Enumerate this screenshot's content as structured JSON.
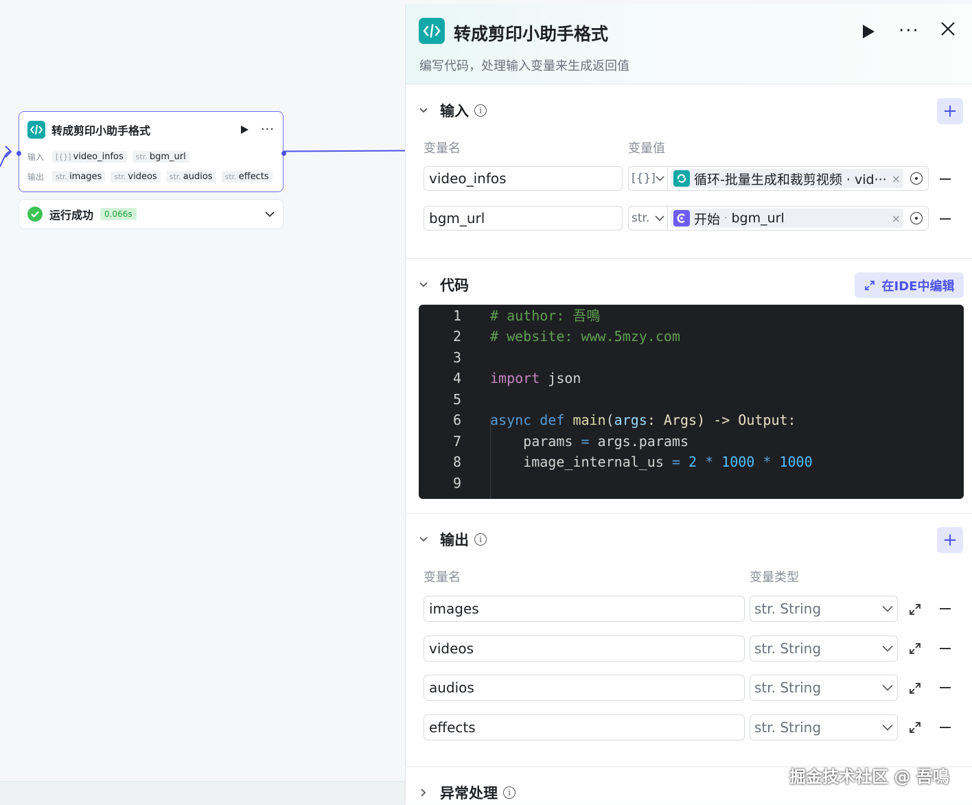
{
  "canvas": {
    "node": {
      "title": "转成剪印小助手格式",
      "input_label": "输入",
      "output_label": "输出",
      "inputs": [
        {
          "type": "[{}]",
          "name": "video_infos"
        },
        {
          "type": "str.",
          "name": "bgm_url"
        }
      ],
      "outputs": [
        {
          "type": "str.",
          "name": "images"
        },
        {
          "type": "str.",
          "name": "videos"
        },
        {
          "type": "str.",
          "name": "audios"
        },
        {
          "type": "str.",
          "name": "effects"
        }
      ]
    },
    "run_status": {
      "text": "运行成功",
      "time": "0.066s"
    }
  },
  "panel": {
    "title": "转成剪印小助手格式",
    "subtitle": "编写代码，处理输入变量来生成返回值",
    "input_section": {
      "title": "输入",
      "col_name": "变量名",
      "col_value": "变量值",
      "rows": [
        {
          "name": "video_infos",
          "type": "[{}]",
          "ref_text": "循环-批量生成和裁剪视频 · vid···",
          "ref_color": "#13a8a8"
        },
        {
          "name": "bgm_url",
          "type": "str.",
          "ref_node": "开始",
          "ref_sep": "·",
          "ref_var": "bgm_url",
          "ref_color": "#6e5cf2"
        }
      ]
    },
    "code_section": {
      "title": "代码",
      "ide_button": "在IDE中编辑",
      "line_numbers": [
        "1",
        "2",
        "3",
        "4",
        "5",
        "6",
        "7",
        "8",
        "9"
      ],
      "lines": {
        "l1": "# author: 吾鳴",
        "l2": "# website: www.5mzy.com",
        "l4_kw": "import",
        "l4_rest": " json",
        "l6_async": "async",
        "l6_def": "def",
        "l6_fn": "main",
        "l6_p1": "(",
        "l6_arg": "args",
        "l6_p2": ": Args) -> Output:",
        "l7_a": "params",
        "l7_b": " = ",
        "l7_c": "args.params",
        "l8_a": "image_internal_us",
        "l8_b": " = ",
        "l8_n1": "2",
        "l8_op1": " * ",
        "l8_n2": "1000",
        "l8_op2": " * ",
        "l8_n3": "1000"
      }
    },
    "output_section": {
      "title": "输出",
      "col_name": "变量名",
      "col_type": "变量类型",
      "rows": [
        {
          "name": "images",
          "type": "str. String"
        },
        {
          "name": "videos",
          "type": "str. String"
        },
        {
          "name": "audios",
          "type": "str. String"
        },
        {
          "name": "effects",
          "type": "str. String"
        }
      ]
    },
    "error_section": {
      "title": "异常处理"
    }
  },
  "watermark": "掘金技术社区 @ 吾鳴",
  "colors": {
    "accent": "#4d53e8",
    "code_badge": "#13a8a8",
    "success": "#3ec254"
  }
}
